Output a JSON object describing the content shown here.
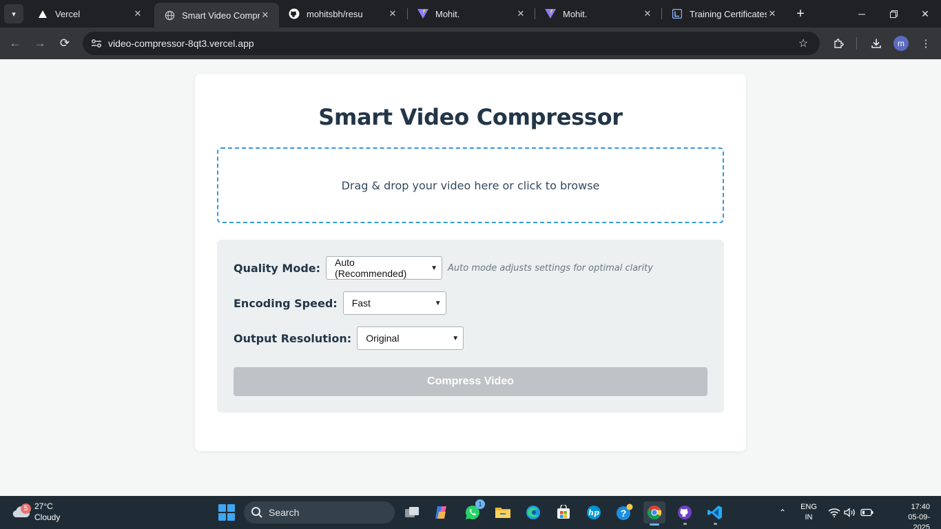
{
  "browser": {
    "tabs": [
      {
        "title": "Vercel",
        "icon": "vercel-logo-icon",
        "active": false
      },
      {
        "title": "Smart Video Compres",
        "icon": "globe-icon",
        "active": true
      },
      {
        "title": "mohitsbh/resu",
        "icon": "github-icon",
        "active": false
      },
      {
        "title": "Mohit.",
        "icon": "vite-logo-icon",
        "active": false
      },
      {
        "title": "Mohit.",
        "icon": "vite-logo-icon",
        "active": false
      },
      {
        "title": "Training Certificates |",
        "icon": "linkedin-learning-icon",
        "active": false
      }
    ],
    "url": "video-compressor-8qt3.vercel.app",
    "profile_initial": "m"
  },
  "page": {
    "title": "Smart Video Compressor",
    "dropzone_text": "Drag & drop your video here or click to browse",
    "settings": {
      "quality_label": "Quality Mode:",
      "quality_value": "Auto (Recommended)",
      "quality_hint": "Auto mode adjusts settings for optimal clarity",
      "speed_label": "Encoding Speed:",
      "speed_value": "Fast",
      "resolution_label": "Output Resolution:",
      "resolution_value": "Original"
    },
    "compress_button": "Compress Video"
  },
  "taskbar": {
    "weather_badge": "5",
    "temperature": "27°C",
    "condition": "Cloudy",
    "search_placeholder": "Search",
    "whatsapp_badge": "1",
    "language": "ENG",
    "region": "IN",
    "time": "17:40",
    "date": "05-09-2025"
  },
  "colors": {
    "accent": "#3498db",
    "title": "#233648",
    "button_disabled": "#bdc3c7",
    "panel": "#ecf0f1"
  }
}
